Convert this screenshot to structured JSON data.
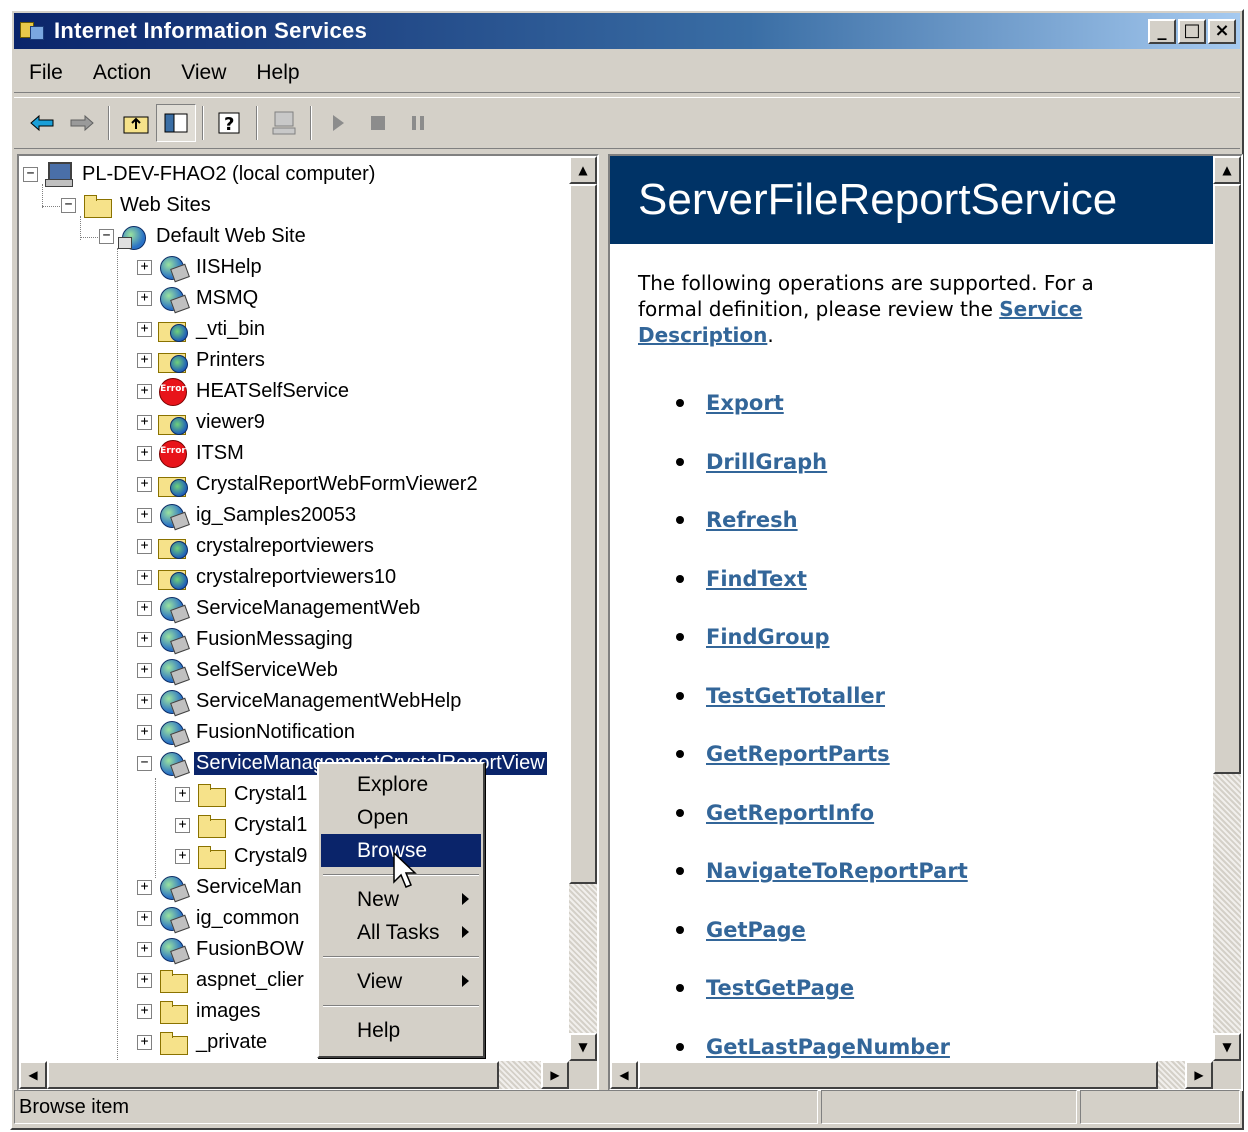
{
  "window": {
    "title": "Internet Information Services",
    "buttons": {
      "minimize": "_",
      "maximize": "□",
      "close": "×"
    }
  },
  "menubar": [
    "File",
    "Action",
    "View",
    "Help"
  ],
  "toolbar": {
    "buttons": [
      "back-arrow-icon",
      "forward-arrow-icon",
      "up-folder-icon",
      "show-tree-icon",
      "help-icon",
      "computer-icon",
      "play-icon",
      "stop-icon",
      "pause-icon"
    ]
  },
  "tree": {
    "root": "PL-DEV-FHAO2 (local computer)",
    "web_sites": "Web Sites",
    "default_site": "Default Web Site",
    "items": [
      "IISHelp",
      "MSMQ",
      "_vti_bin",
      "Printers",
      "HEATSelfService",
      "viewer9",
      "ITSM",
      "CrystalReportWebFormViewer2",
      "ig_Samples20053",
      "crystalreportviewers",
      "crystalreportviewers10",
      "ServiceManagementWeb",
      "FusionMessaging",
      "SelfServiceWeb",
      "ServiceManagementWebHelp",
      "FusionNotification",
      "ServiceManagementCrystalReportView"
    ],
    "children": [
      "Crystal1",
      "Crystal1",
      "Crystal9"
    ],
    "after": [
      "ServiceMan",
      "ig_common",
      "FusionBOW",
      "aspnet_clier",
      "images",
      "_private"
    ]
  },
  "content": {
    "title": "ServerFileReportService",
    "intro_prefix": "The following operations are supported. For a formal definition, please review the ",
    "intro_link": "Service Description",
    "intro_suffix": ".",
    "operations": [
      "Export",
      "DrillGraph",
      "Refresh",
      "FindText",
      "FindGroup",
      "TestGetTotaller",
      "GetReportParts",
      "GetReportInfo",
      "NavigateToReportPart",
      "GetPage",
      "TestGetPage",
      "GetLastPageNumber"
    ]
  },
  "context_menu": {
    "explore": "Explore",
    "open": "Open",
    "browse": "Browse",
    "new": "New",
    "all_tasks": "All Tasks",
    "view": "View",
    "help": "Help"
  },
  "statusbar": {
    "text": "Browse item"
  }
}
